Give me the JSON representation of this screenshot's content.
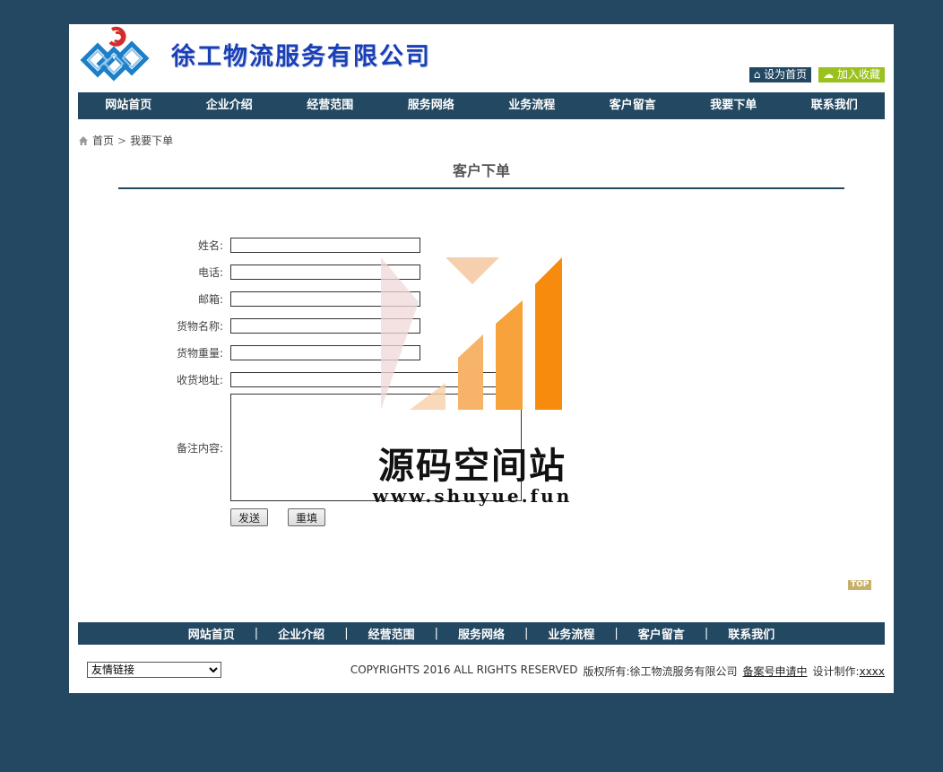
{
  "header": {
    "site_name": "徐工物流服务有限公司",
    "set_home": "设为首页",
    "add_favorite": "加入收藏"
  },
  "nav": {
    "items": [
      "网站首页",
      "企业介绍",
      "经营范围",
      "服务网络",
      "业务流程",
      "客户留言",
      "我要下单",
      "联系我们"
    ]
  },
  "breadcrumb": {
    "home": "首页",
    "separator": ">",
    "current": "我要下单"
  },
  "page_title": "客户下单",
  "form": {
    "name_label": "姓名:",
    "phone_label": "电话:",
    "email_label": "邮箱:",
    "goods_name_label": "货物名称:",
    "goods_weight_label": "货物重量:",
    "address_label": "收货地址:",
    "remark_label": "备注内容:",
    "submit": "发送",
    "reset": "重填"
  },
  "watermark": {
    "text": "源码空间站",
    "url": "www.shuyue.fun"
  },
  "top_badge": "TOP",
  "footer_nav": {
    "items": [
      "网站首页",
      "企业介绍",
      "经营范围",
      "服务网络",
      "业务流程",
      "客户留言",
      "联系我们"
    ],
    "separator": "|"
  },
  "footer": {
    "friend_links": "友情链接",
    "copyright": "COPYRIGHTS 2016  ALL RIGHTS RESERVED",
    "owner": "版权所有:徐工物流服务有限公司",
    "icp": "备案号申请中",
    "design_label": "设计制作:",
    "design_value": "xxxx"
  },
  "colors": {
    "background": "#244862",
    "nav": "#234862",
    "favorite": "#9bc11e",
    "logo_text": "#1a3fb5"
  }
}
